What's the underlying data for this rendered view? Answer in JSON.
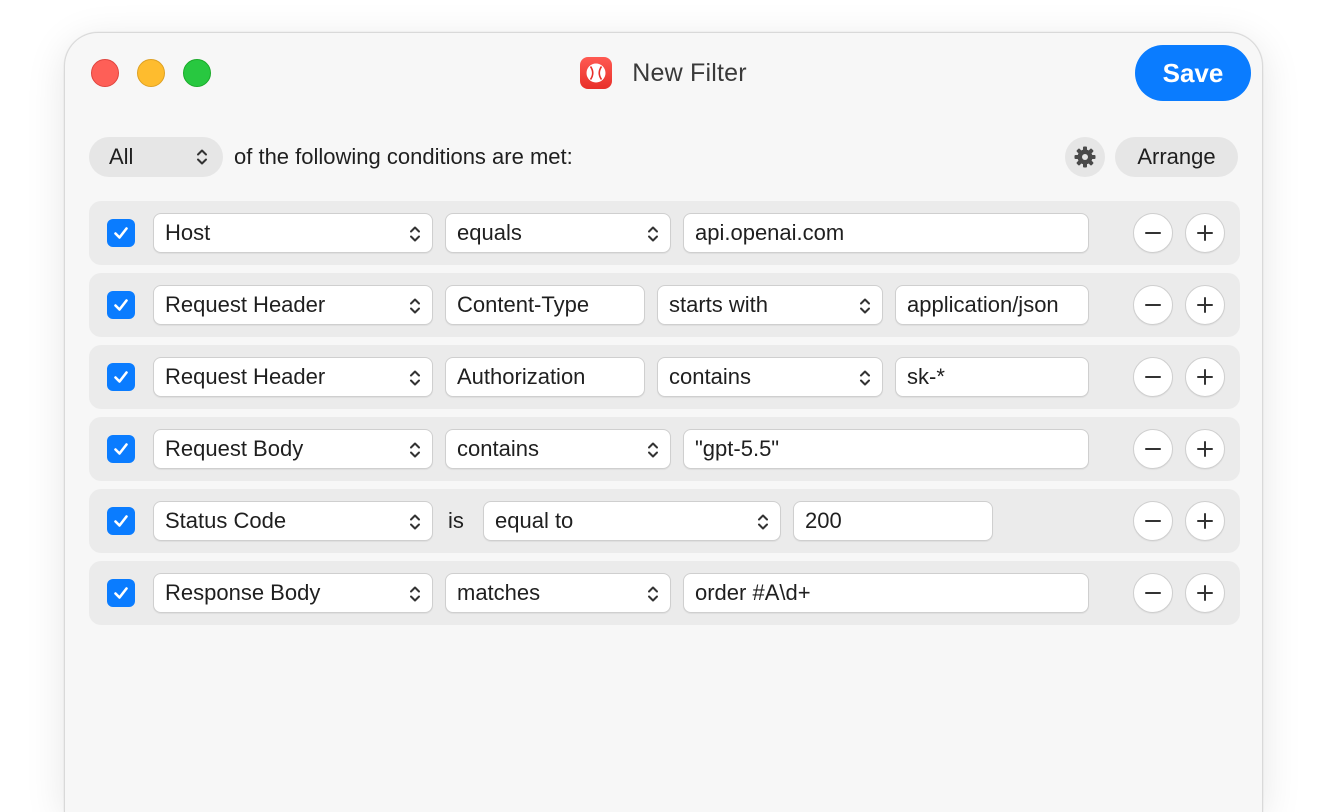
{
  "window": {
    "title": "New Filter",
    "save_label": "Save"
  },
  "conditions": {
    "match_mode": "All",
    "text": "of the following conditions are met:",
    "arrange_label": "Arrange"
  },
  "rules": [
    {
      "enabled": true,
      "field": "Host",
      "operator": "equals",
      "value": "api.openai.com"
    },
    {
      "enabled": true,
      "field": "Request Header",
      "header_name": "Content-Type",
      "operator": "starts with",
      "value": "application/json"
    },
    {
      "enabled": true,
      "field": "Request Header",
      "header_name": "Authorization",
      "operator": "contains",
      "value": "sk-*"
    },
    {
      "enabled": true,
      "field": "Request Body",
      "operator": "contains",
      "value": "\"gpt-5.5\""
    },
    {
      "enabled": true,
      "field": "Status Code",
      "connector": "is",
      "operator": "equal to",
      "value": "200"
    },
    {
      "enabled": true,
      "field": "Response Body",
      "operator": "matches",
      "value": "order #A\\d+"
    }
  ],
  "colors": {
    "accent": "#0a7cff",
    "app_icon": "#ee3a33",
    "close": "#fe5f57",
    "minimize": "#febc2e",
    "zoom": "#28c840"
  },
  "icons": {
    "app": "baseball-icon",
    "options": "gear-icon",
    "remove": "minus-icon",
    "add": "plus-icon",
    "select": "chevron-updown-icon",
    "checked": "checkmark-icon"
  }
}
